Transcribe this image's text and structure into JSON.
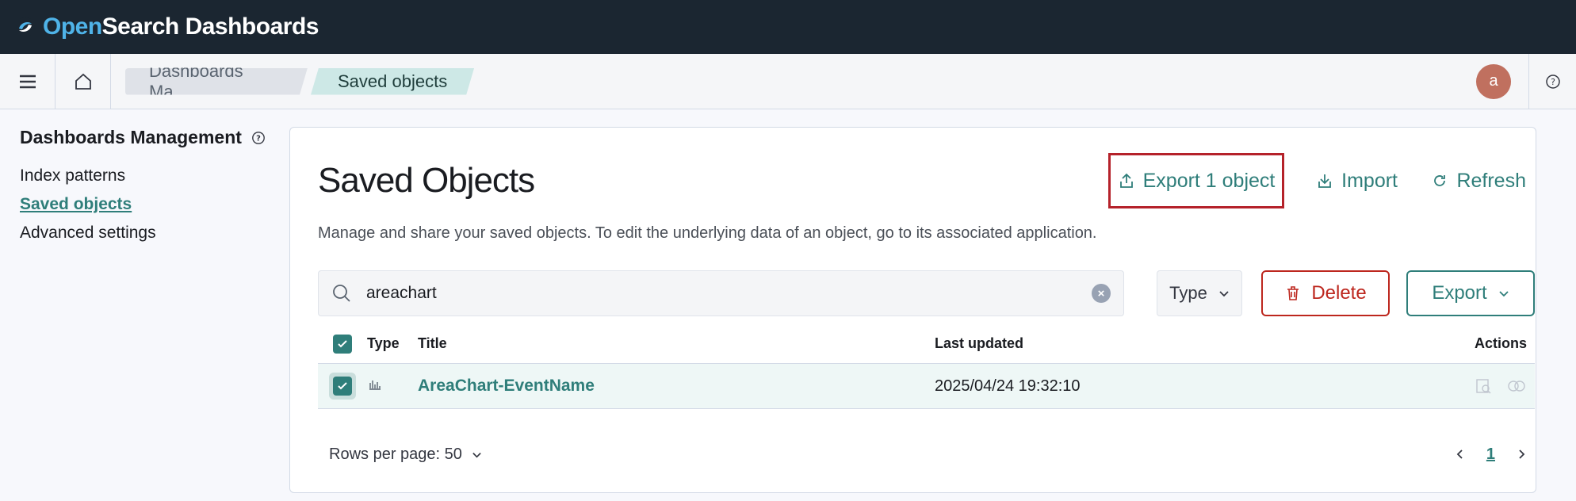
{
  "header": {
    "brand_a": "Open",
    "brand_b": "Search Dashboards"
  },
  "breadcrumbs": [
    "Dashboards Ma…",
    "Saved objects"
  ],
  "user": {
    "avatar_initial": "a"
  },
  "sidebar": {
    "title": "Dashboards Management",
    "items": [
      {
        "label": "Index patterns",
        "active": false
      },
      {
        "label": "Saved objects",
        "active": true
      },
      {
        "label": "Advanced settings",
        "active": false
      }
    ]
  },
  "main": {
    "title": "Saved Objects",
    "description": "Manage and share your saved objects. To edit the underlying data of an object, go to its associated application.",
    "actions": {
      "export_selected": "Export 1 object",
      "import": "Import",
      "refresh": "Refresh"
    },
    "search": {
      "value": "areachart"
    },
    "type_filter": "Type",
    "delete_label": "Delete",
    "export_label": "Export",
    "table": {
      "headers": {
        "type": "Type",
        "title": "Title",
        "last_updated": "Last updated",
        "actions": "Actions"
      },
      "rows": [
        {
          "type_icon": "area-chart-icon",
          "title": "AreaChart-EventName",
          "last_updated": "2025/04/24 19:32:10",
          "selected": true
        }
      ]
    },
    "pagination": {
      "rows_per_page": "Rows per page: 50",
      "current_page": "1"
    }
  },
  "colors": {
    "accent": "#2f7e7a",
    "danger": "#bd271e",
    "topbar": "#1b2631",
    "highlight": "#b5222a"
  }
}
